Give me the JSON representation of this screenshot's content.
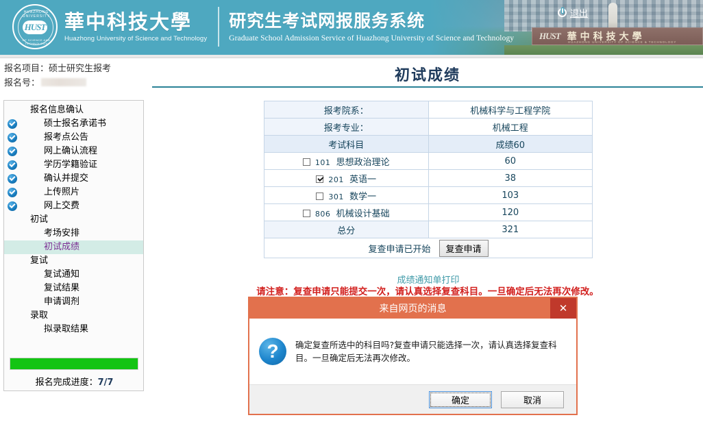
{
  "header": {
    "seal_top_text": "HUAZHONG UNIVERSITY",
    "seal_bottom_text": "OF SCIENCE AND TECHNOLOGY",
    "seal_logo": "HUST",
    "university_cn": "華中科技大學",
    "university_en": "Huazhong University of Science  and Technology",
    "system_cn": "研究生考试网报服务系统",
    "system_en": "Graduate School Admission Service of Huazhong University of Science and Technology",
    "logout_label": "退出",
    "logout_icon": "power-icon",
    "sign_logo": "HUST",
    "sign_cn": "華中科技大學",
    "sign_en": "HUAZHONG UNIVERSITY OF SCIENCE & TECHNOLOGY"
  },
  "topinfo": {
    "project_label": "报名项目：",
    "project_value": "硕士研究生报考",
    "regno_label": "报名号：",
    "regno_value": ""
  },
  "page": {
    "title": "初试成绩"
  },
  "sidebar": {
    "items": [
      {
        "label": "报名信息确认",
        "level": 1,
        "done": false,
        "active": false
      },
      {
        "label": "硕士报名承诺书",
        "level": 2,
        "done": true,
        "active": false
      },
      {
        "label": "报考点公告",
        "level": 2,
        "done": true,
        "active": false
      },
      {
        "label": "网上确认流程",
        "level": 2,
        "done": true,
        "active": false
      },
      {
        "label": "学历学籍验证",
        "level": 2,
        "done": true,
        "active": false
      },
      {
        "label": "确认并提交",
        "level": 2,
        "done": true,
        "active": false
      },
      {
        "label": "上传照片",
        "level": 2,
        "done": true,
        "active": false
      },
      {
        "label": "网上交费",
        "level": 2,
        "done": true,
        "active": false
      },
      {
        "label": "初试",
        "level": 1,
        "done": false,
        "active": false
      },
      {
        "label": "考场安排",
        "level": 2,
        "done": false,
        "active": false
      },
      {
        "label": "初试成绩",
        "level": 2,
        "done": false,
        "active": true
      },
      {
        "label": "复试",
        "level": 1,
        "done": false,
        "active": false
      },
      {
        "label": "复试通知",
        "level": 2,
        "done": false,
        "active": false
      },
      {
        "label": "复试结果",
        "level": 2,
        "done": false,
        "active": false
      },
      {
        "label": "申请调剂",
        "level": 2,
        "done": false,
        "active": false
      },
      {
        "label": "录取",
        "level": 1,
        "done": false,
        "active": false
      },
      {
        "label": "拟录取结果",
        "level": 2,
        "done": false,
        "active": false
      }
    ],
    "progress_label": "报名完成进度：",
    "progress_value": "7/7",
    "progress_percent": 100,
    "progress_color": "#13c413"
  },
  "score_table": {
    "rows": [
      {
        "type": "info",
        "label": "报考院系：",
        "value": "机械科学与工程学院"
      },
      {
        "type": "info",
        "label": "报考专业：",
        "value": "机械工程"
      },
      {
        "type": "head",
        "label": "考试科目",
        "value": "成绩60"
      },
      {
        "type": "subject",
        "checked": false,
        "code": "101",
        "name": "思想政治理论",
        "value": "60"
      },
      {
        "type": "subject",
        "checked": true,
        "code": "201",
        "name": "英语一",
        "value": "38"
      },
      {
        "type": "subject",
        "checked": false,
        "code": "301",
        "name": "数学一",
        "value": "103"
      },
      {
        "type": "subject",
        "checked": false,
        "code": "806",
        "name": "机械设计基础",
        "value": "120"
      },
      {
        "type": "total",
        "label": "总分",
        "value": "321"
      }
    ],
    "apply_status_text": "复查申请已开始",
    "apply_button_label": "复查申请",
    "print_link_label": "成绩通知单打印",
    "warning_text": "请注意：复查申请只能提交一次，请认真选择复查科目。一旦确定后无法再次修改。"
  },
  "dialog": {
    "title": "来自网页的消息",
    "close_icon": "close-icon",
    "question_icon": "question-mark-icon",
    "message": "确定复查所选中的科目吗?复查申请只能选择一次，请认真选择复查科目。一旦确定后无法再次修改。",
    "confirm_label": "确定",
    "cancel_label": "取消"
  },
  "colors": {
    "header_bg": "#4ea8c0",
    "title_text": "#1f3b5c",
    "dialog_accent": "#e2714d",
    "dialog_close": "#c0392b",
    "warning": "#d2201e",
    "active_menu_bg": "#d3ece6",
    "active_menu_text": "#7b2f93",
    "link": "#3f9aa8"
  }
}
